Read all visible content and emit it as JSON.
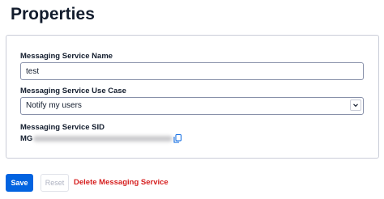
{
  "page": {
    "title": "Properties"
  },
  "form": {
    "name": {
      "label": "Messaging Service Name",
      "value": "test"
    },
    "use_case": {
      "label": "Messaging Service Use Case",
      "selected": "Notify my users"
    },
    "sid": {
      "label": "Messaging Service SID",
      "visible_prefix": "MG"
    }
  },
  "actions": {
    "save_label": "Save",
    "reset_label": "Reset",
    "delete_label": "Delete Messaging Service"
  },
  "icons": {
    "copy": "copy-icon",
    "dropdown": "chevron-down-icon"
  },
  "colors": {
    "primary": "#0263e0",
    "destructive": "#d61f1f",
    "disabled": "#aeb2c1"
  }
}
